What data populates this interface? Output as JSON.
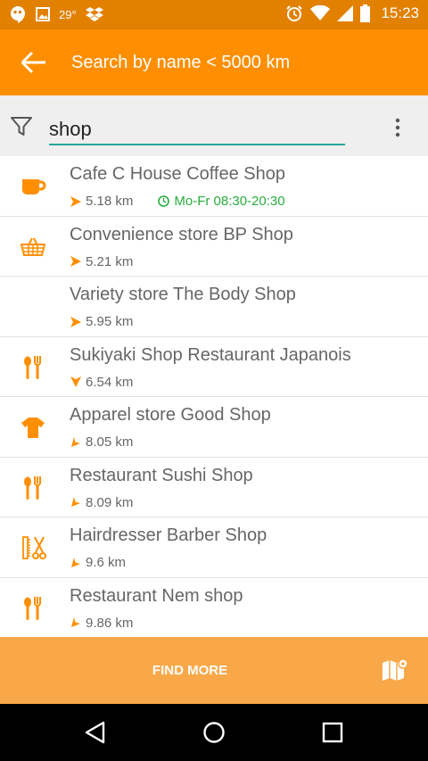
{
  "status_bar": {
    "temperature": "29°",
    "time": "15:23",
    "left_icons": [
      "hangouts-icon",
      "image-icon",
      "dropbox-icon"
    ],
    "right_icons": [
      "alarm-icon",
      "wifi-icon",
      "signal-icon",
      "battery-icon"
    ]
  },
  "app_bar": {
    "title": "Search by name  < 5000 km",
    "back_icon": "arrow-left-icon",
    "color": "#ff8f00"
  },
  "search": {
    "value": "shop",
    "filter_icon": "filter-icon",
    "menu_icon": "more-vert-icon",
    "underline_color": "#26a69a"
  },
  "results": [
    {
      "name": "Cafe C House Coffee Shop",
      "distance": "5.18 km",
      "icon": "coffee-cup-icon",
      "direction": "east",
      "hours": "Mo-Fr 08:30-20:30"
    },
    {
      "name": "Convenience store BP Shop",
      "distance": "5.21 km",
      "icon": "basket-icon",
      "direction": "east"
    },
    {
      "name": "Variety store The Body Shop",
      "distance": "5.95 km",
      "icon": "",
      "direction": "east"
    },
    {
      "name": "Sukiyaki Shop Restaurant Japanois",
      "distance": "6.54 km",
      "icon": "restaurant-icon",
      "direction": "south"
    },
    {
      "name": "Apparel store Good Shop",
      "distance": "8.05 km",
      "icon": "tshirt-icon",
      "direction": "southwest"
    },
    {
      "name": "Restaurant Sushi Shop",
      "distance": "8.09 km",
      "icon": "restaurant-icon",
      "direction": "southwest"
    },
    {
      "name": "Hairdresser Barber Shop",
      "distance": "9.6 km",
      "icon": "comb-scissors-icon",
      "direction": "southwest"
    },
    {
      "name": "Restaurant Nem shop",
      "distance": "9.86 km",
      "icon": "restaurant-icon",
      "direction": "southwest"
    }
  ],
  "bottom_bar": {
    "find_more_label": "FIND MORE",
    "map_icon": "map-icon"
  },
  "nav_bar": {
    "buttons": [
      "back-triangle-icon",
      "home-circle-icon",
      "recents-square-icon"
    ]
  },
  "colors": {
    "accent": "#ff8f00",
    "status_bar": "#e28000",
    "open_hours": "#27ae3d",
    "bottom_bar": "#f9a849"
  }
}
